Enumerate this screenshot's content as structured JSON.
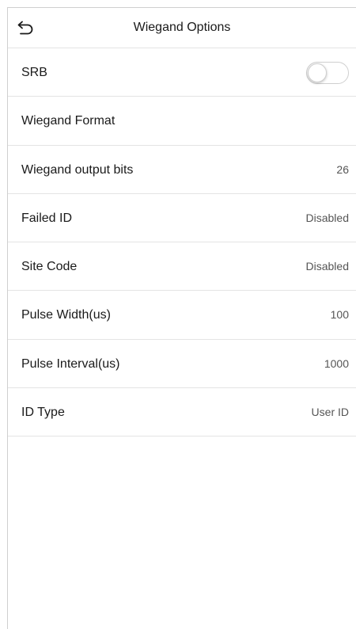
{
  "header": {
    "title": "Wiegand Options",
    "back_icon": "back-arrow-icon"
  },
  "settings": {
    "srb": {
      "label": "SRB",
      "state": "off"
    },
    "wiegand_format": {
      "label": "Wiegand Format"
    },
    "output_bits": {
      "label": "Wiegand output bits",
      "value": "26"
    },
    "failed_id": {
      "label": "Failed ID",
      "value": "Disabled"
    },
    "site_code": {
      "label": "Site Code",
      "value": "Disabled"
    },
    "pulse_width": {
      "label": "Pulse Width(us)",
      "value": "100"
    },
    "pulse_interval": {
      "label": "Pulse Interval(us)",
      "value": "1000"
    },
    "id_type": {
      "label": "ID Type",
      "value": "User ID"
    }
  },
  "colors": {
    "divider": "#e4e4e4",
    "text": "#1a1a1a",
    "value_text": "#555555",
    "toggle_border": "#cfcfcf"
  }
}
